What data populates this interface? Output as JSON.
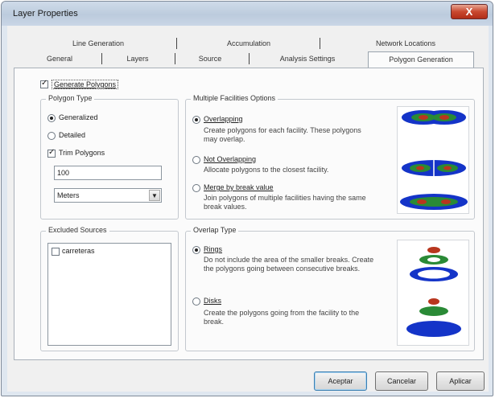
{
  "window": {
    "title": "Layer Properties",
    "close_label": "X"
  },
  "tabs": {
    "row1": [
      "Line Generation",
      "Accumulation",
      "Network Locations"
    ],
    "row2": [
      "General",
      "Layers",
      "Source",
      "Analysis Settings",
      "Polygon Generation"
    ],
    "active": "Polygon Generation"
  },
  "generate_polygons": {
    "label": "Generate Polygons",
    "checked": true
  },
  "polygon_type": {
    "title": "Polygon Type",
    "options": [
      {
        "label": "Generalized",
        "checked": true
      },
      {
        "label": "Detailed",
        "checked": false
      }
    ],
    "trim": {
      "label": "Trim Polygons",
      "checked": true
    },
    "trim_value": "100",
    "units_selected": "Meters"
  },
  "multiple_facilities": {
    "title": "Multiple Facilities Options",
    "options": [
      {
        "label": "Overlapping",
        "desc": "Create polygons for each facility. These polygons may overlap.",
        "checked": true
      },
      {
        "label": "Not Overlapping",
        "desc": "Allocate polygons to the closest facility.",
        "checked": false
      },
      {
        "label": "Merge by break value",
        "desc": "Join polygons of multiple facilities having the same break values.",
        "checked": false
      }
    ]
  },
  "excluded_sources": {
    "title": "Excluded Sources",
    "items": [
      {
        "label": "carreteras",
        "checked": false
      }
    ]
  },
  "overlap_type": {
    "title": "Overlap Type",
    "options": [
      {
        "label": "Rings",
        "desc": "Do not include the area of the smaller breaks. Create the polygons going between consecutive breaks.",
        "checked": true
      },
      {
        "label": "Disks",
        "desc": "Create the polygons going from the facility to the break.",
        "checked": false
      }
    ]
  },
  "buttons": {
    "accept": "Aceptar",
    "cancel": "Cancelar",
    "apply": "Aplicar"
  },
  "colors": {
    "polygon_blue": "#1434c8",
    "polygon_green": "#2a8a36",
    "polygon_red": "#b8361e",
    "ring_white": "#ffffff"
  }
}
